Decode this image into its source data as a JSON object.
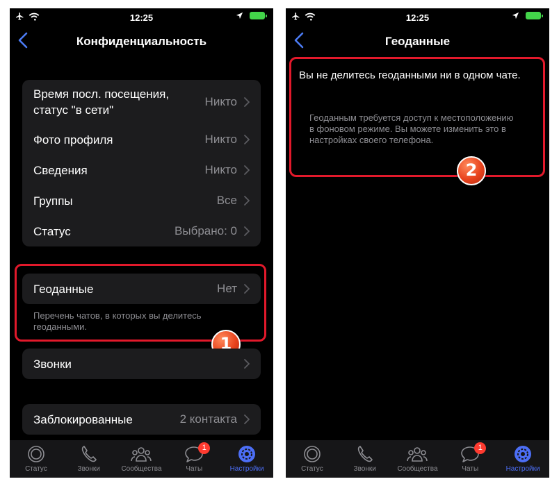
{
  "status_bar": {
    "time": "12:25"
  },
  "screen1": {
    "title": "Конфиденциальность",
    "privacy_rows": [
      {
        "label": "Время посл. посещения, статус \"в сети\"",
        "value": "Никто"
      },
      {
        "label": "Фото профиля",
        "value": "Никто"
      },
      {
        "label": "Сведения",
        "value": "Никто"
      },
      {
        "label": "Группы",
        "value": "Все"
      },
      {
        "label": "Статус",
        "value": "Выбрано: 0"
      }
    ],
    "geo_row": {
      "label": "Геоданные",
      "value": "Нет"
    },
    "geo_footnote": "Перечень чатов, в которых вы делитесь геоданными.",
    "calls_row": {
      "label": "Звонки"
    },
    "blocked_row": {
      "label": "Заблокированные",
      "value": "2 контакта"
    },
    "callout_number": "1"
  },
  "screen2": {
    "title": "Геоданные",
    "message": "Вы не делитесь геоданными ни в одном чате.",
    "note": "Геоданным требуется доступ к местоположению в фоновом режиме. Вы можете изменить это в настройках своего телефона.",
    "callout_number": "2"
  },
  "tabs": [
    {
      "label": "Статус",
      "icon": "status-icon"
    },
    {
      "label": "Звонки",
      "icon": "phone-icon"
    },
    {
      "label": "Сообщества",
      "icon": "communities-icon"
    },
    {
      "label": "Чаты",
      "icon": "chats-icon",
      "badge": "1"
    },
    {
      "label": "Настройки",
      "icon": "settings-icon",
      "active": true
    }
  ],
  "colors": {
    "accent": "#4c6ef5",
    "callout": "#e2192b",
    "badge": "#ff3b30",
    "battery": "#43d44a"
  }
}
